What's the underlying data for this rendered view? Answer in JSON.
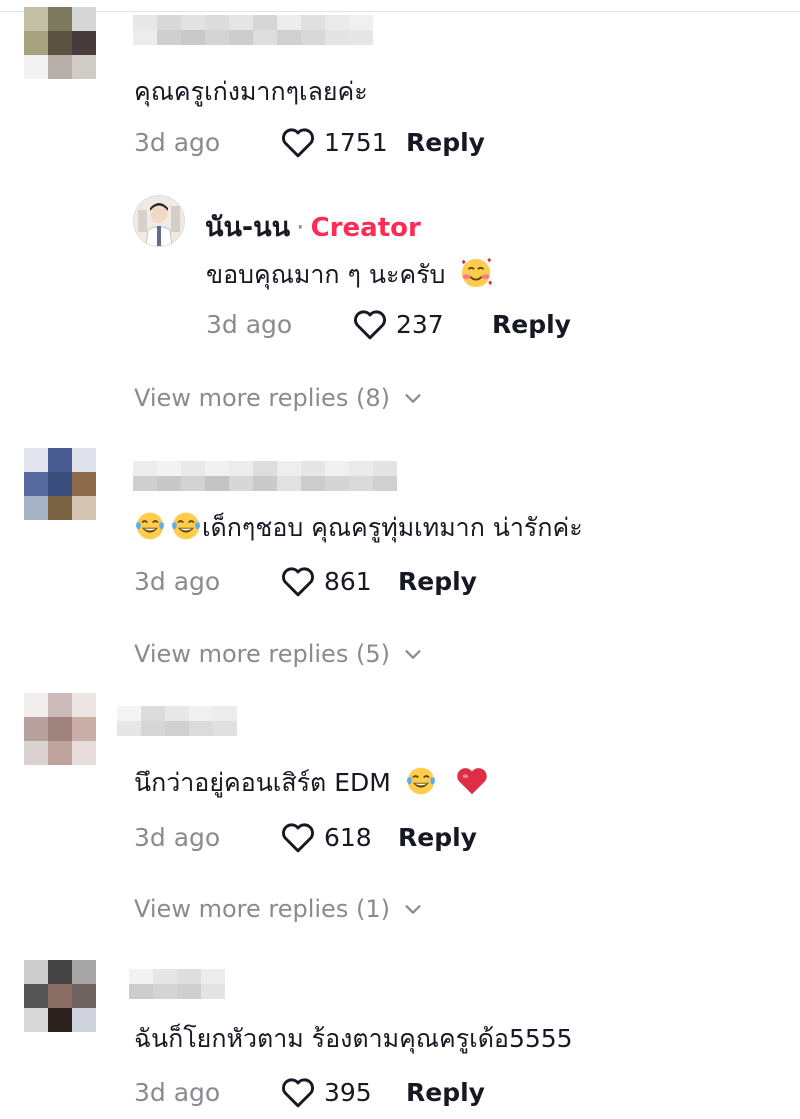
{
  "comments": [
    {
      "text": "คุณครูเก่งมากๆเลยค่ะ",
      "age": "3d ago",
      "likes": "1751",
      "reply_label": "Reply",
      "avatar_colors": [
        "#c3c0a6",
        "#7b785e",
        "#d7d7d7",
        "#a8a37f",
        "#5b5241",
        "#463a3b",
        "#f2f2f2",
        "#b7aea8",
        "#d2ccc6"
      ],
      "creator_reply": {
        "name": "นัน-นน",
        "separator": "·",
        "badge": "Creator",
        "text": "ขอบคุณมาก ๆ นะครับ",
        "emoji": "smiling-face-with-hearts",
        "age": "3d ago",
        "likes": "237",
        "reply_label": "Reply"
      },
      "view_more": "View more replies (8)"
    },
    {
      "text": "เด็กๆชอบ คุณครูทุ่มเทมาก น่ารักค่ะ",
      "emojis_before": [
        "face-with-tears-of-joy",
        "face-with-tears-of-joy"
      ],
      "age": "3d ago",
      "likes": "861",
      "reply_label": "Reply",
      "avatar_colors": [
        "#e4e5ee",
        "#485c93",
        "#dfe1ea",
        "#56689d",
        "#3b4e7e",
        "#8c6a4a",
        "#a4b2c6",
        "#7b6240",
        "#d7c5b4"
      ],
      "view_more": "View more replies (5)"
    },
    {
      "text": "นึกว่าอยู่คอนเสิร์ต EDM",
      "emojis_after": [
        "face-with-tears-of-joy",
        "red-heart"
      ],
      "age": "3d ago",
      "likes": "618",
      "reply_label": "Reply",
      "avatar_colors": [
        "#f2eeee",
        "#cbbab7",
        "#ece5e4",
        "#b8a19d",
        "#9f837c",
        "#c8aea7",
        "#d9d2d0",
        "#bfa49e",
        "#e6dcd9"
      ],
      "view_more": "View more replies (1)"
    },
    {
      "text": "ฉันก็โยกหัวตาม ร้องตามคุณครูเด้อ5555",
      "age": "3d ago",
      "likes": "395",
      "reply_label": "Reply",
      "avatar_colors": [
        "#cdcdcd",
        "#444444",
        "#a6a6a6",
        "#555555",
        "#8a6d63",
        "#6f615d",
        "#d9d9d9",
        "#2e2220",
        "#cfd3dc"
      ]
    }
  ],
  "colors": {
    "accent": "#fe2c55",
    "muted": "#8a8b91",
    "text": "#161823"
  }
}
